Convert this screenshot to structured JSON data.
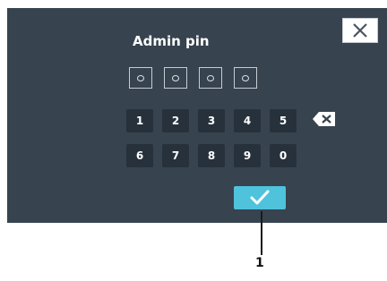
{
  "dialog": {
    "title": "Admin pin",
    "pin_slots": 4,
    "keys": [
      "1",
      "2",
      "3",
      "4",
      "5",
      "6",
      "7",
      "8",
      "9",
      "0"
    ],
    "confirm_icon": "checkmark-icon",
    "close_icon": "close-icon",
    "backspace_icon": "backspace-icon"
  },
  "callout": {
    "label": "1"
  },
  "colors": {
    "screen_bg": "#37434f",
    "key_bg": "#26313b",
    "accent": "#4fc3dc"
  }
}
